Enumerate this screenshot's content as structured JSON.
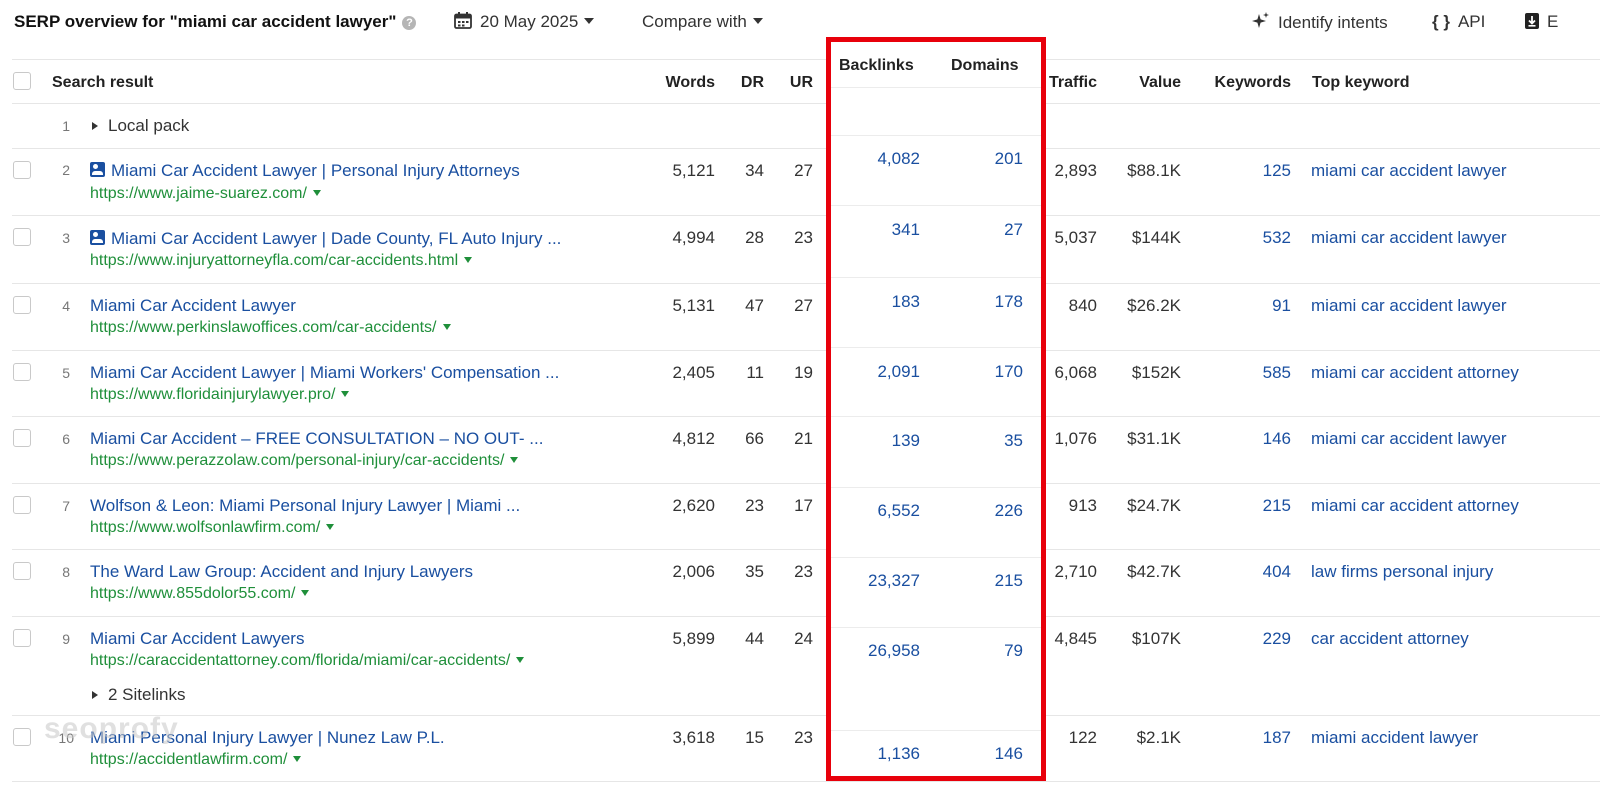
{
  "header": {
    "title": "SERP overview for \"miami car accident lawyer\"",
    "help": "?",
    "date": "20 May 2025",
    "compare_label": "Compare with",
    "identify_label": "Identify intents",
    "api_label": "API",
    "export_label": "E"
  },
  "columns": {
    "search_result": "Search result",
    "words": "Words",
    "dr": "DR",
    "ur": "UR",
    "backlinks": "Backlinks",
    "domains": "Domains",
    "traffic": "Traffic",
    "value": "Value",
    "keywords": "Keywords",
    "top_keyword": "Top keyword"
  },
  "local_pack": {
    "num": "1",
    "label": "Local pack"
  },
  "sitelinks_label": "2 Sitelinks",
  "watermark": "seoprofy",
  "rows": [
    {
      "num": "2",
      "title": "Miami Car Accident Lawyer | Personal Injury Attorneys",
      "url": "https://www.jaime-suarez.com/",
      "words": "5,121",
      "dr": "34",
      "ur": "27",
      "backlinks": "4,082",
      "domains": "201",
      "traffic": "2,893",
      "value": "$88.1K",
      "keywords": "125",
      "top_keyword": "miami car accident lawyer"
    },
    {
      "num": "3",
      "title": "Miami Car Accident Lawyer | Dade County, FL Auto Injury ...",
      "url": "https://www.injuryattorneyfla.com/car-accidents.html",
      "words": "4,994",
      "dr": "28",
      "ur": "23",
      "backlinks": "341",
      "domains": "27",
      "traffic": "5,037",
      "value": "$144K",
      "keywords": "532",
      "top_keyword": "miami car accident lawyer"
    },
    {
      "num": "4",
      "title": "Miami Car Accident Lawyer",
      "url": "https://www.perkinslawoffices.com/car-accidents/",
      "words": "5,131",
      "dr": "47",
      "ur": "27",
      "backlinks": "183",
      "domains": "178",
      "traffic": "840",
      "value": "$26.2K",
      "keywords": "91",
      "top_keyword": "miami car accident lawyer"
    },
    {
      "num": "5",
      "title": "Miami Car Accident Lawyer | Miami Workers' Compensation ...",
      "url": "https://www.floridainjurylawyer.pro/",
      "words": "2,405",
      "dr": "11",
      "ur": "19",
      "backlinks": "2,091",
      "domains": "170",
      "traffic": "6,068",
      "value": "$152K",
      "keywords": "585",
      "top_keyword": "miami car accident attorney"
    },
    {
      "num": "6",
      "title": "Miami Car Accident – FREE CONSULTATION – NO OUT- ...",
      "url": "https://www.perazzolaw.com/personal-injury/car-accidents/",
      "words": "4,812",
      "dr": "66",
      "ur": "21",
      "backlinks": "139",
      "domains": "35",
      "traffic": "1,076",
      "value": "$31.1K",
      "keywords": "146",
      "top_keyword": "miami car accident lawyer"
    },
    {
      "num": "7",
      "title": "Wolfson & Leon: Miami Personal Injury Lawyer | Miami ...",
      "url": "https://www.wolfsonlawfirm.com/",
      "words": "2,620",
      "dr": "23",
      "ur": "17",
      "backlinks": "6,552",
      "domains": "226",
      "traffic": "913",
      "value": "$24.7K",
      "keywords": "215",
      "top_keyword": "miami car accident attorney"
    },
    {
      "num": "8",
      "title": "The Ward Law Group: Accident and Injury Lawyers",
      "url": "https://www.855dolor55.com/",
      "words": "2,006",
      "dr": "35",
      "ur": "23",
      "backlinks": "23,327",
      "domains": "215",
      "traffic": "2,710",
      "value": "$42.7K",
      "keywords": "404",
      "top_keyword": "law firms personal injury"
    },
    {
      "num": "9",
      "title": "Miami Car Accident Lawyers",
      "url": "https://caraccidentattorney.com/florida/miami/car-accidents/",
      "words": "5,899",
      "dr": "44",
      "ur": "24",
      "backlinks": "26,958",
      "domains": "79",
      "traffic": "4,845",
      "value": "$107K",
      "keywords": "229",
      "top_keyword": "car accident attorney"
    },
    {
      "num": "10",
      "title": "Miami Personal Injury Lawyer | Nunez Law P.L.",
      "url": "https://accidentlawfirm.com/",
      "words": "3,618",
      "dr": "15",
      "ur": "23",
      "backlinks": "1,136",
      "domains": "146",
      "traffic": "122",
      "value": "$2.1K",
      "keywords": "187",
      "top_keyword": "miami accident lawyer"
    }
  ]
}
